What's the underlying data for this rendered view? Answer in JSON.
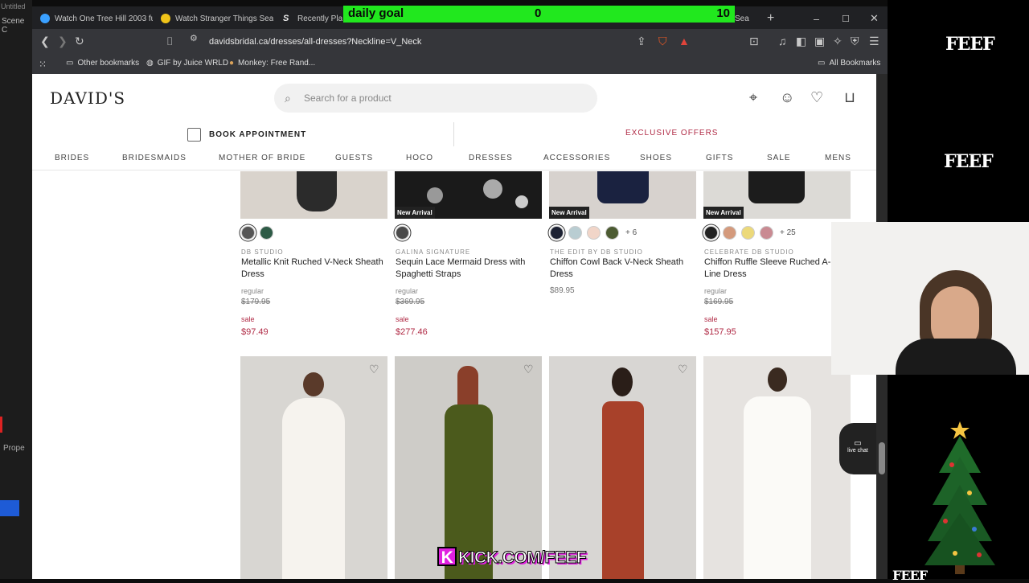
{
  "obs": {
    "untitled": "Untitled",
    "scene": "Scene C",
    "properties": "Prope"
  },
  "tabs": [
    {
      "label": "Watch One Tree Hill 2003 fu",
      "icon": "play-icon"
    },
    {
      "label": "Watch Stranger Things Seas",
      "icon": "smiley-icon"
    },
    {
      "label": "Recently Playe",
      "icon": "s-logo-icon"
    },
    {
      "label": "Sea",
      "icon": "tab-icon"
    }
  ],
  "goal": {
    "label": "daily goal",
    "current": "0",
    "target": "10"
  },
  "url": "davidsbridal.ca/dresses/all-dresses?Neckline=V_Neck",
  "bookmarks": {
    "other": "Other bookmarks",
    "gif": "GIF by Juice WRLD",
    "monkey": "Monkey: Free Rand...",
    "all": "All Bookmarks"
  },
  "site": {
    "logo": "DAVID'S",
    "search_placeholder": "Search for a product",
    "book": "BOOK APPOINTMENT",
    "offers": "EXCLUSIVE OFFERS",
    "nav": [
      "BRIDES",
      "BRIDESMAIDS",
      "MOTHER OF BRIDE",
      "GUESTS",
      "HOCO",
      "DRESSES",
      "ACCESSORIES",
      "SHOES",
      "GIFTS",
      "SALE",
      "MENS"
    ]
  },
  "products": [
    {
      "brand": "DB STUDIO",
      "name": "Metallic Knit Ruched V-Neck Sheath Dress",
      "regular_label": "regular",
      "regular": "$179.95",
      "sale_label": "sale",
      "sale": "$97.49",
      "swatches": [
        "#555555",
        "#2e5b46"
      ],
      "more": ""
    },
    {
      "brand": "GALINA SIGNATURE",
      "name": "Sequin Lace Mermaid Dress with Spaghetti Straps",
      "regular_label": "regular",
      "regular": "$369.95",
      "sale_label": "sale",
      "sale": "$277.46",
      "new": "New Arrival",
      "swatches": [
        "#4a4a4a"
      ],
      "more": ""
    },
    {
      "brand": "THE EDIT BY DB STUDIO",
      "name": "Chiffon Cowl Back V-Neck Sheath Dress",
      "price": "$89.95",
      "new": "New Arrival",
      "swatches": [
        "#1d2233",
        "#b9cdd2",
        "#f1d5c8",
        "#4c5b32"
      ],
      "more": "+ 6"
    },
    {
      "brand": "CELEBRATE DB STUDIO",
      "name": "Chiffon Ruffle Sleeve Ruched A-Line Dress",
      "regular_label": "regular",
      "regular": "$169.95",
      "sale_label": "sale",
      "sale": "$157.95",
      "new": "New Arrival",
      "swatches": [
        "#222222",
        "#d49a7c",
        "#ecd97a",
        "#c98a92"
      ],
      "more": "+ 25"
    }
  ],
  "livechat": "live chat",
  "kick": "KICK.COM/FEEF",
  "feef": "FEEF"
}
